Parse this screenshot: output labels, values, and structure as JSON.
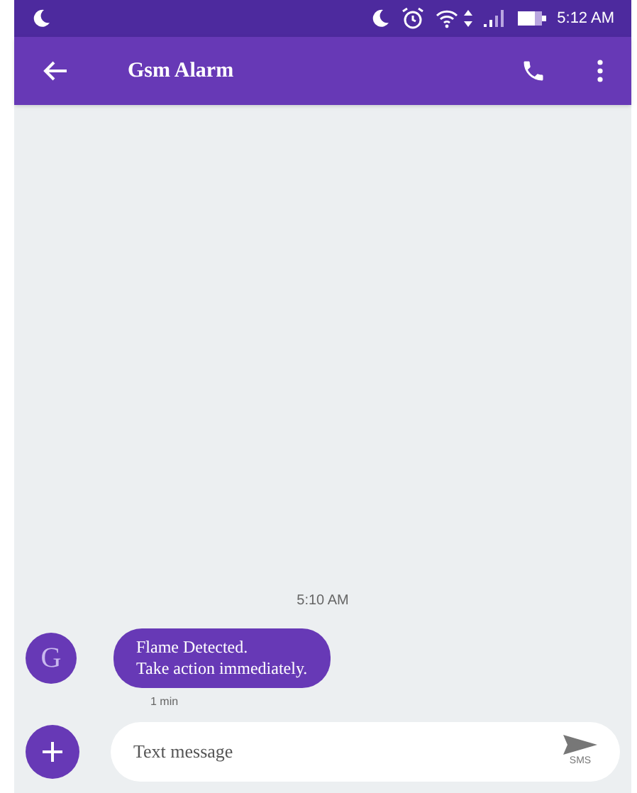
{
  "status_bar": {
    "time": "5:12 AM"
  },
  "app_bar": {
    "title": "Gsm Alarm"
  },
  "conversation": {
    "timestamp": "5:10 AM",
    "messages": [
      {
        "avatar": "G",
        "text": "Flame Detected.\nTake action immediately.",
        "age": "1 min"
      }
    ]
  },
  "composer": {
    "placeholder": "Text message",
    "send_label": "SMS"
  }
}
